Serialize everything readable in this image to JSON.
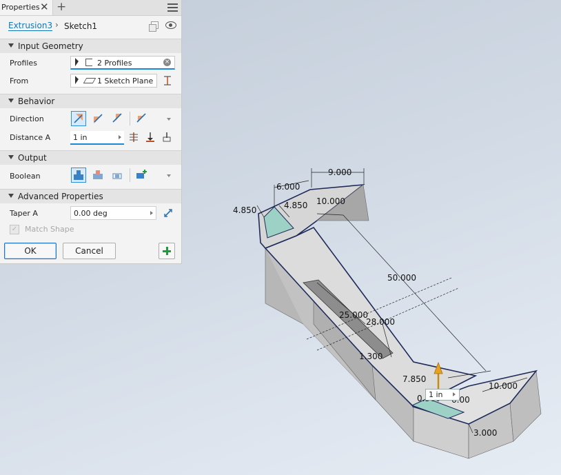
{
  "panel": {
    "tab_label": "Properties",
    "close_glyph": "✕",
    "add_glyph": "+",
    "breadcrumb": {
      "feature": "Extrusion3",
      "separator": "›",
      "sketch": "Sketch1"
    },
    "sections": {
      "input_geometry": "Input Geometry",
      "behavior": "Behavior",
      "output": "Output",
      "advanced": "Advanced Properties"
    },
    "labels": {
      "profiles": "Profiles",
      "from": "From",
      "direction": "Direction",
      "distance_a": "Distance A",
      "boolean": "Boolean",
      "taper_a": "Taper A",
      "match_shape": "Match Shape"
    },
    "profiles_value": "2 Profiles",
    "from_value": "1 Sketch Plane",
    "distance_value": "1 in",
    "taper_value": "0.00 deg",
    "match_shape_checked": true,
    "ok_label": "OK",
    "cancel_label": "Cancel",
    "icons": [
      "select-arrow-icon",
      "profile-icon",
      "sketch-plane-icon",
      "clear-icon",
      "flip-icon",
      "direction-default-icon",
      "direction-flipped-icon",
      "direction-symmetric-icon",
      "direction-asymmetric-icon",
      "distance-icon",
      "to-icon",
      "to-next-icon",
      "between-icon",
      "join-icon",
      "cut-icon",
      "intersect-icon",
      "new-solid-icon",
      "add-icon",
      "eye-icon",
      "copy-icon",
      "menu-icon"
    ]
  },
  "viewport": {
    "dimensions": [
      "9.000",
      "6.000",
      "4.850",
      "4.850",
      "10.000",
      "50.000",
      "25.000",
      "28.000",
      "1.300",
      "7.850",
      "10.000",
      "3.000",
      "0.300",
      "6.00"
    ],
    "mini_toolbar_value": "1 in",
    "accent_colors": {
      "selection_blue": "#1b88d6",
      "arrow_orange": "#e8a020",
      "profile_green": "#9ed1c6"
    }
  }
}
